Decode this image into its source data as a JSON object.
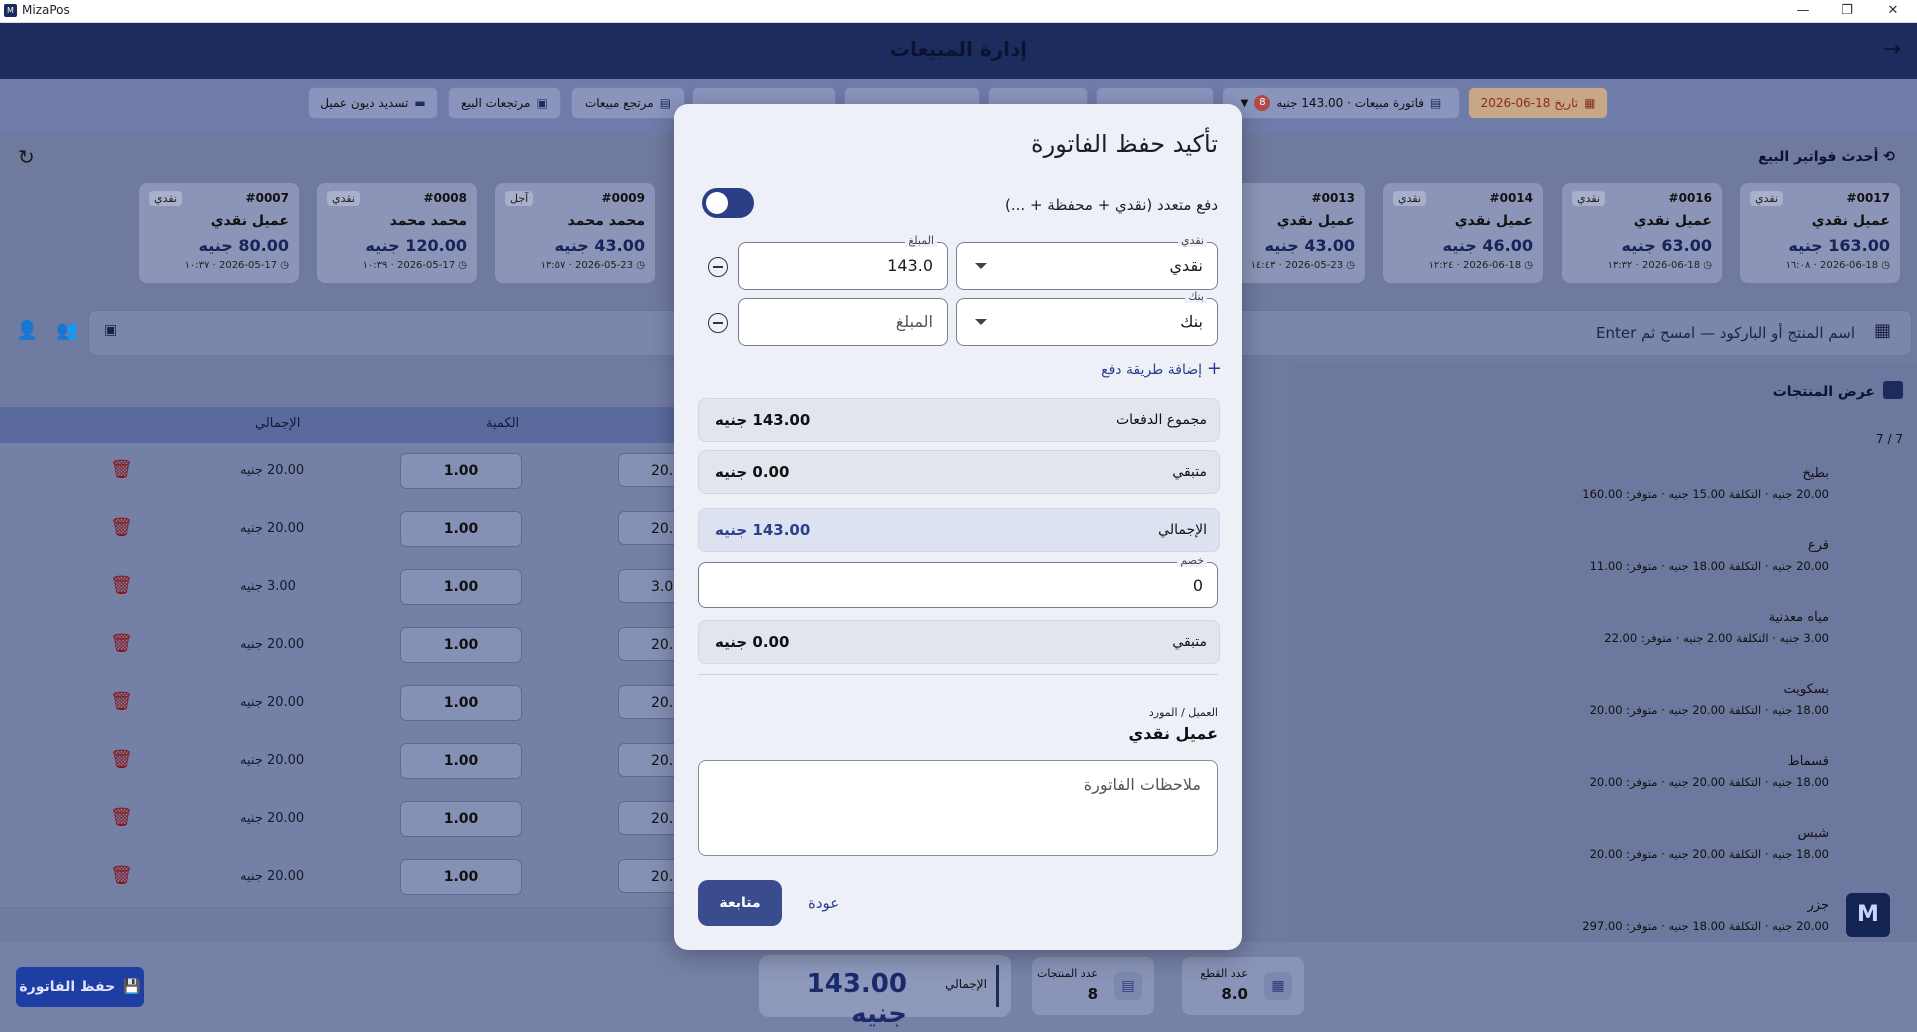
{
  "window": {
    "title": "MizaPos",
    "controls": [
      "—",
      "❐",
      "✕"
    ]
  },
  "header": {
    "title": "إدارة المبيعات",
    "back_icon": "→"
  },
  "toolbar": {
    "date": "تاريخ 18-06-2026",
    "invoice_type": "فاتورة مبيعات · 143.00 جنيه",
    "invoice_badge": "8",
    "sales_return": "مرتجع مبيعات",
    "sale_returns": "مرتجعات البيع",
    "customer_debt": "تسديد ديون عميل"
  },
  "recent": {
    "title": "أحدث فواتير البيع",
    "cards": [
      {
        "num": "#0017",
        "type": "نقدي",
        "customer": "عميل نقدي",
        "amount": "163.00 جنيه",
        "date": "2026-06-18 · ١٦:٠٨"
      },
      {
        "num": "#0016",
        "type": "نقدي",
        "customer": "عميل نقدي",
        "amount": "63.00 جنيه",
        "date": "2026-06-18 · ١٣:٣٢"
      },
      {
        "num": "#0014",
        "type": "نقدي",
        "customer": "عميل نقدي",
        "amount": "46.00 جنيه",
        "date": "2026-06-18 · ١٢:٢٤"
      },
      {
        "num": "#0013",
        "type": "",
        "customer": "عميل نقدي",
        "amount": "43.00 جنيه",
        "date": "2026-05-23 · ١٤:٤٣"
      },
      {
        "num": "#0009",
        "type": "آجل",
        "customer": "محمد محمد",
        "amount": "43.00 جنيه",
        "date": "2026-05-23 · ١٣:٥٧"
      },
      {
        "num": "#0008",
        "type": "نقدي",
        "customer": "محمد محمد",
        "amount": "120.00 جنيه",
        "date": "2026-05-17 · ١٠:٣٩"
      },
      {
        "num": "#0007",
        "type": "نقدي",
        "customer": "عميل نقدي",
        "amount": "80.00 جنيه",
        "date": "2026-05-17 · ١٠:٣٧"
      }
    ]
  },
  "search": {
    "placeholder": "اسم المنتج أو الباركود — امسح ثم Enter"
  },
  "table": {
    "headers": {
      "total": "الإجمالي",
      "qty": "الكمية"
    },
    "rows": [
      {
        "total": "20.00 جنيه",
        "qty": "1.00",
        "price": "20.0"
      },
      {
        "total": "20.00 جنيه",
        "qty": "1.00",
        "price": "20.0"
      },
      {
        "total": "3.00 جنيه",
        "qty": "1.00",
        "price": "3.0"
      },
      {
        "total": "20.00 جنيه",
        "qty": "1.00",
        "price": "20.0"
      },
      {
        "total": "20.00 جنيه",
        "qty": "1.00",
        "price": "20.0"
      },
      {
        "total": "20.00 جنيه",
        "qty": "1.00",
        "price": "20.0"
      },
      {
        "total": "20.00 جنيه",
        "qty": "1.00",
        "price": "20.0"
      },
      {
        "total": "20.00 جنيه",
        "qty": "1.00",
        "price": "20.0"
      }
    ]
  },
  "products": {
    "title": "عرض المنتجات",
    "count": "7 / 7",
    "items": [
      {
        "name": "بطيخ",
        "detail": "20.00 جنيه · التكلفة 15.00 جنيه · متوفر: 160.00"
      },
      {
        "name": "قرع",
        "detail": "20.00 جنيه · التكلفة 18.00 جنيه · متوفر: 11.00"
      },
      {
        "name": "مياه معدنية",
        "detail": "3.00 جنيه · التكلفة 2.00 جنيه · متوفر: 22.00"
      },
      {
        "name": "بسكويت",
        "detail": "18.00 جنيه · التكلفة 20.00 جنيه · متوفر: 20.00"
      },
      {
        "name": "قسماط",
        "detail": "18.00 جنيه · التكلفة 20.00 جنيه · متوفر: 20.00"
      },
      {
        "name": "شبس",
        "detail": "18.00 جنيه · التكلفة 20.00 جنيه · متوفر: 20.00"
      },
      {
        "name": "جزر",
        "detail": "20.00 جنيه · التكلفة 18.00 جنيه · متوفر: 297.00"
      }
    ]
  },
  "bottom": {
    "save_invoice": "حفظ الفاتورة",
    "pieces_label": "عدد القطع",
    "pieces_value": "8.0",
    "products_label": "عدد المنتجات",
    "products_value": "8",
    "total_label": "الإجمالي",
    "total_value": "143.00 جنيه"
  },
  "modal": {
    "title": "تأكيد حفظ الفاتورة",
    "multi_payment": "دفع متعدد (نقدي + محفظة + ...)",
    "multi_enabled": true,
    "payments": [
      {
        "method_label": "نقدي",
        "method_value": "نقدي",
        "amount_label": "المبلغ",
        "amount_value": "143.0"
      },
      {
        "method_label": "بنك",
        "method_value": "بنك",
        "amount_placeholder": "المبلغ"
      }
    ],
    "add_payment": "إضافة طريقة دفع",
    "payments_total_label": "مجموع الدفعات",
    "payments_total_value": "143.00 جنيه",
    "remaining_label": "متبقي",
    "remaining_value": "0.00 جنيه",
    "grand_total_label": "الإجمالي",
    "grand_total_value": "143.00 جنيه",
    "discount_label": "خصم",
    "discount_value": "0",
    "remaining2_label": "متبقي",
    "remaining2_value": "0.00 جنيه",
    "customer_label": "العميل / المورد",
    "customer_value": "عميل نقدي",
    "notes_placeholder": "ملاحظات الفاتورة",
    "continue": "متابعة",
    "back": "عودة"
  },
  "colors": {
    "primary": "#1d2c5f",
    "accent": "#2c3f8f",
    "danger": "#8a1010",
    "date_chip": "#c7a786"
  }
}
